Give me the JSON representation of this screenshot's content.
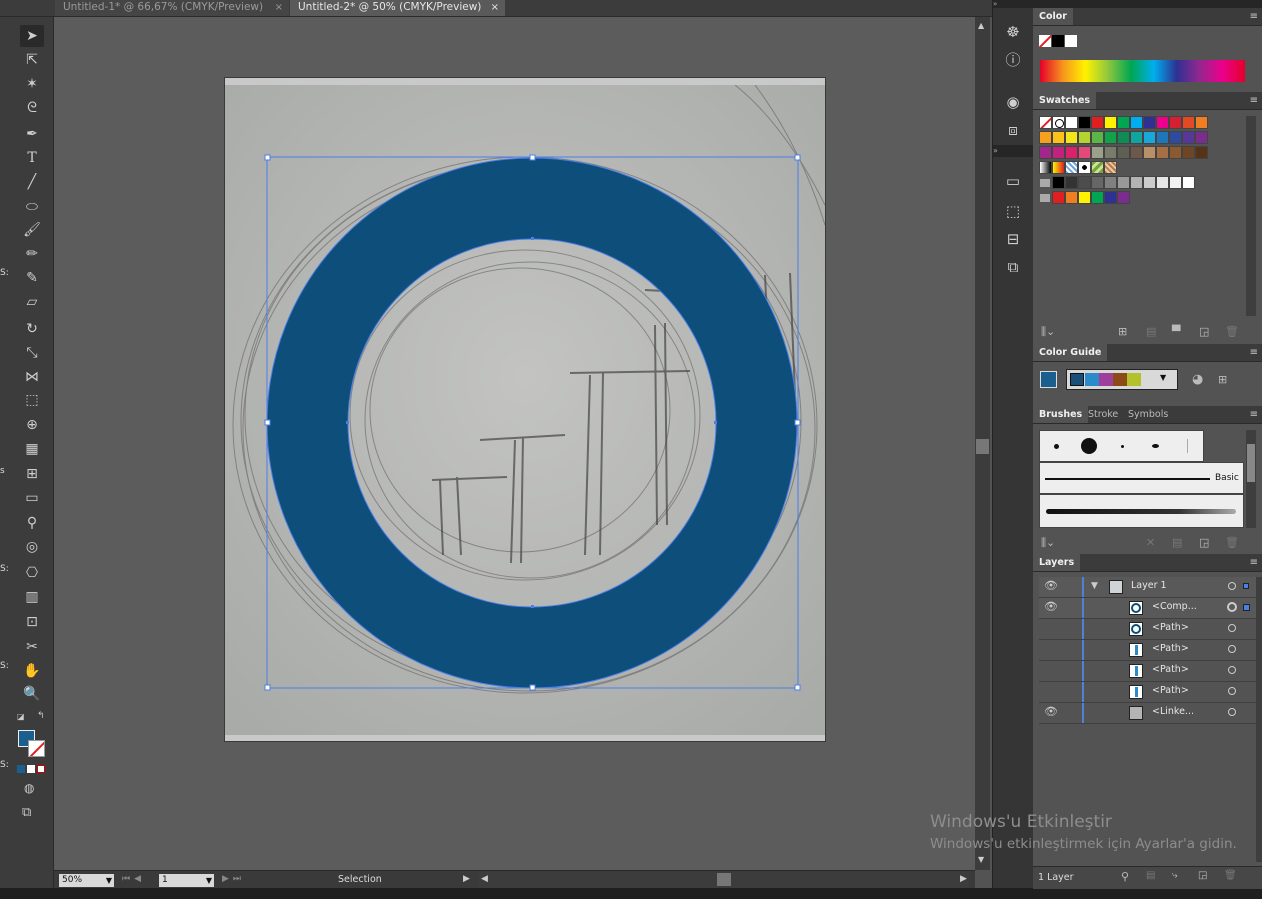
{
  "tabs": [
    {
      "label": "Untitled-1* @ 66,67% (CMYK/Preview)",
      "close": "×"
    },
    {
      "label": "Untitled-2* @ 50% (CMYK/Preview)",
      "close": "×"
    }
  ],
  "tools": [
    "selection-tool",
    "direct-selection-tool",
    "magic-wand-tool",
    "lasso-tool",
    "pen-tool",
    "type-tool",
    "line-tool",
    "ellipse-tool",
    "paintbrush-tool",
    "pencil-tool",
    "blob-brush-tool",
    "eraser-tool",
    "rotate-tool",
    "scale-tool",
    "width-tool",
    "free-transform-tool",
    "shape-builder-tool",
    "perspective-grid-tool",
    "mesh-tool",
    "gradient-tool",
    "eyedropper-tool",
    "blend-tool",
    "symbol-sprayer-tool",
    "column-graph-tool",
    "artboard-tool",
    "slice-tool",
    "hand-tool",
    "zoom-tool"
  ],
  "side_fragments": [
    "S:",
    "s",
    "S:",
    "S:",
    "S:"
  ],
  "status": {
    "zoom": "50%",
    "page": "1",
    "mode": "Selection"
  },
  "panels": {
    "color": {
      "title": "Color"
    },
    "swatches": {
      "title": "Swatches"
    },
    "color_guide": {
      "title": "Color Guide"
    },
    "brushes": {
      "tabs": [
        "Brushes",
        "Stroke",
        "Symbols"
      ],
      "basic_label": "Basic"
    },
    "layers": {
      "title": "Layers",
      "footer": "1 Layer"
    }
  },
  "layers": [
    {
      "name": "Layer 1",
      "visible": true,
      "expandable": true
    },
    {
      "name": "<Comp...",
      "visible": true
    },
    {
      "name": "<Path>",
      "visible": false
    },
    {
      "name": "<Path>",
      "visible": false
    },
    {
      "name": "<Path>",
      "visible": false
    },
    {
      "name": "<Path>",
      "visible": false
    },
    {
      "name": "<Linke...",
      "visible": true
    }
  ],
  "watermark": {
    "line1": "Windows'u Etkinleştir",
    "line2": "Windows'u etkinleştirmek için Ayarlar'a gidin."
  },
  "colors": {
    "ring_fill": "#0d4f7a",
    "selection": "#4a7ee8",
    "fill_swatch": "#1b5f8e"
  }
}
